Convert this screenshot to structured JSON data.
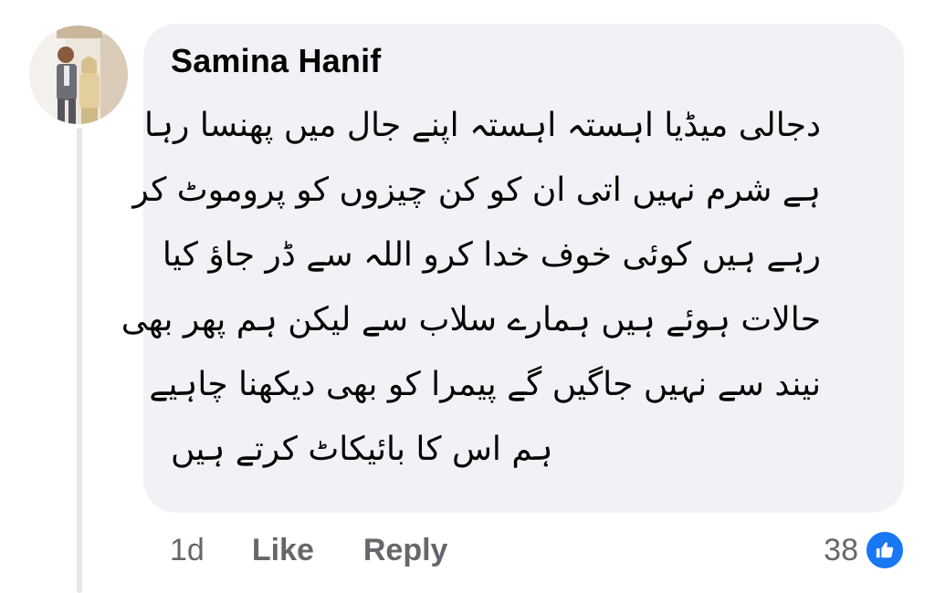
{
  "comment": {
    "author": "Samina Hanif",
    "text_lines": [
      "دجالی میڈیا اہستہ اہستہ اپنے جال میں پھنسا رہا",
      "ہے شرم نہیں اتی ان کو کن چیزوں کو پروموٹ کر",
      "رہے ہیں کوئی خوف خدا کرو اللہ سے ڈر جاؤ کیا",
      "حالات ہوئے ہیں ہمارے سلاب سے لیکن ہم پھر بھی",
      "نیند سے نہیں جاگیں گے پیمرا کو بھی دیکھنا چاہیے",
      "ہم اس کا بائیکاٹ کرتے ہیں"
    ],
    "time": "1d",
    "like_label": "Like",
    "reply_label": "Reply",
    "reaction_count": "38",
    "reaction_icon": "thumbs-up-icon"
  },
  "colors": {
    "bubble_bg": "#f0f2f5",
    "secondary_text": "#65676b",
    "like_blue": "#1877f2",
    "thread_line": "#e4e6eb"
  }
}
